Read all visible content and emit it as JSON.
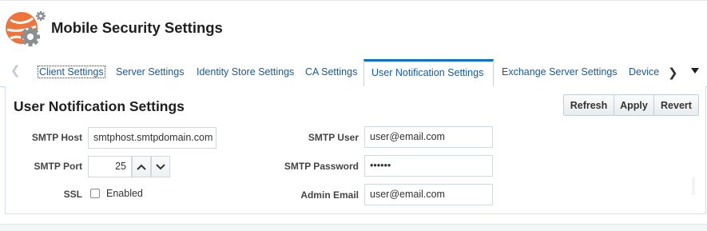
{
  "app": {
    "title": "Mobile Security Settings"
  },
  "tabs": {
    "items": [
      {
        "label": "Client Settings"
      },
      {
        "label": "Server Settings"
      },
      {
        "label": "Identity Store Settings"
      },
      {
        "label": "CA Settings"
      },
      {
        "label": "User Notification Settings",
        "active": true
      },
      {
        "label": "Exchange Server Settings"
      },
      {
        "label": "Device"
      }
    ]
  },
  "panel": {
    "title": "User Notification Settings",
    "buttons": {
      "refresh": "Refresh",
      "apply": "Apply",
      "revert": "Revert"
    }
  },
  "form": {
    "smtp_host": {
      "label": "SMTP Host",
      "value": "smtphost.smtpdomain.com"
    },
    "smtp_port": {
      "label": "SMTP Port",
      "value": "25"
    },
    "ssl": {
      "label": "SSL",
      "option": "Enabled",
      "checked": false
    },
    "smtp_user": {
      "label": "SMTP User",
      "value": "user@email.com"
    },
    "smtp_password": {
      "label": "SMTP Password",
      "value": "••••••"
    },
    "admin_email": {
      "label": "Admin Email",
      "value": "user@email.com"
    }
  },
  "colors": {
    "accent": "#0572ce",
    "link": "#145c9e",
    "logo_orange": "#f0733a",
    "logo_gear": "#8a8f93"
  }
}
